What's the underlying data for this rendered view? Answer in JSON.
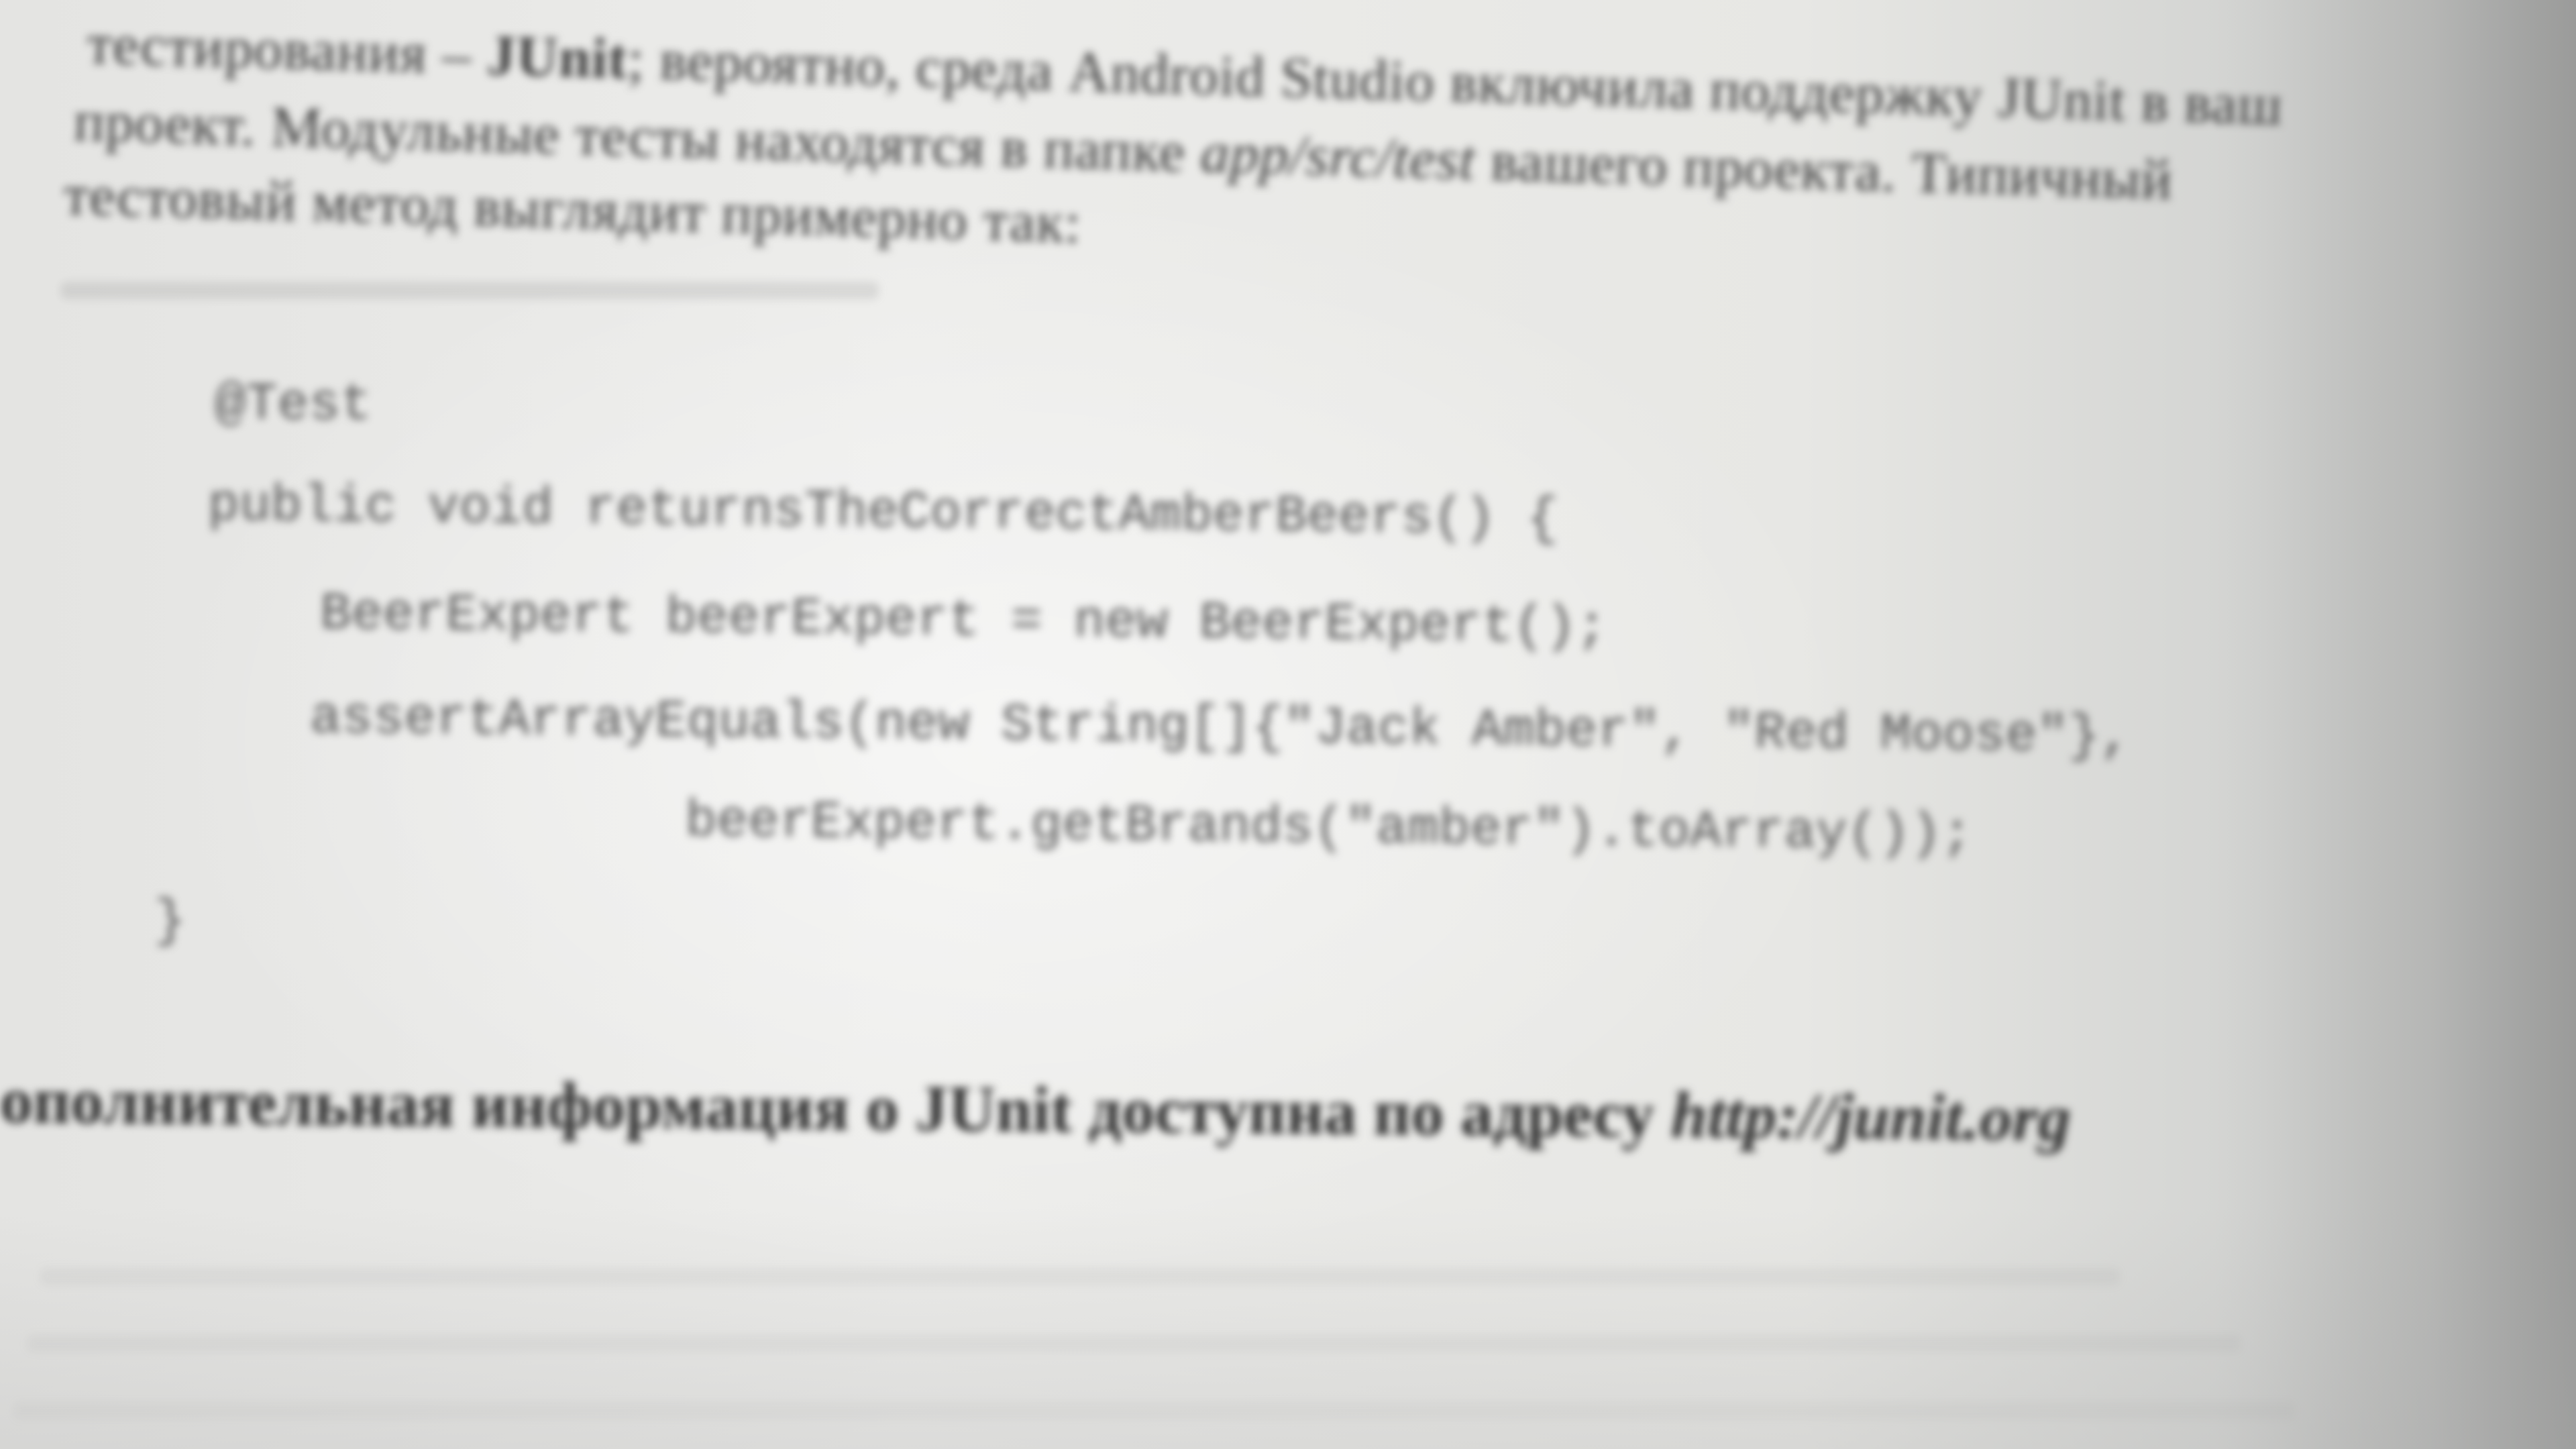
{
  "paragraph": {
    "line1": "тестирования –",
    "line1_bold": "JUnit",
    "line1_rest": "; вероятно, среда Android Studio включила поддержку JUnit в ваш",
    "line2a": "проект. Модульные тесты находятся в папке ",
    "line2_path": "app/src/test",
    "line2b": " вашего проекта. Типичный",
    "line3": "тестовый метод выглядит примерно так:"
  },
  "code": {
    "lines": [
      "@Test",
      "public void returnsTheCorrectAmberBeers() {",
      "    BeerExpert beerExpert = new BeerExpert();",
      "    assertArrayEquals(new String[]{\"Jack Amber\", \"Red Moose\"},",
      "            beerExpert.getBrands(\"amber\").toArray());",
      "}"
    ]
  },
  "info": {
    "text": "ополнительная информация о JUnit доступна по адресу ",
    "link": "http://junit.org"
  }
}
